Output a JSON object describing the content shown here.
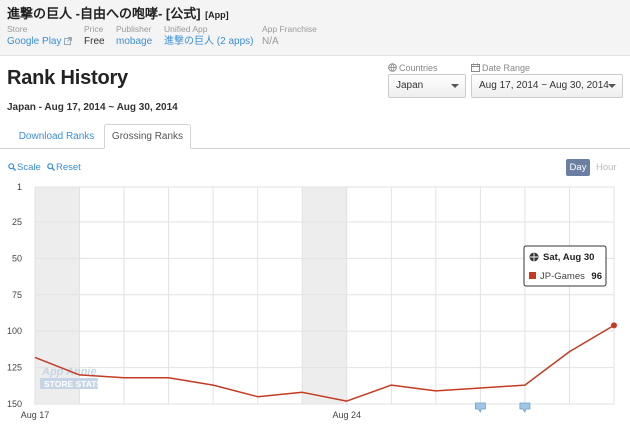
{
  "app": {
    "title": "進撃の巨人 -自由への咆哮- [公式]",
    "tag": "[App]",
    "meta": {
      "store": {
        "label": "Store",
        "value": "Google Play"
      },
      "price": {
        "label": "Price",
        "value": "Free"
      },
      "publisher": {
        "label": "Publisher",
        "value": "mobage"
      },
      "unified_app": {
        "label": "Unified App",
        "value": "進撃の巨人 (2 apps)"
      },
      "franchise": {
        "label": "App Franchise",
        "value": "N/A"
      }
    }
  },
  "page": {
    "title": "Rank History",
    "subtitle": "Japan - Aug 17, 2014 ~ Aug 30, 2014"
  },
  "filters": {
    "countries": {
      "label": "Countries",
      "value": "Japan"
    },
    "date_range": {
      "label": "Date Range",
      "value": "Aug 17, 2014 ~ Aug 30, 2014"
    }
  },
  "tabs": [
    {
      "label": "Download Ranks",
      "active": false
    },
    {
      "label": "Grossing Ranks",
      "active": true
    }
  ],
  "toolbar": {
    "scale_label": "Scale",
    "reset_label": "Reset",
    "granularity": {
      "day": "Day",
      "hour": "Hour",
      "selected": "Day"
    }
  },
  "tooltip": {
    "title": "Sat, Aug 30",
    "series": "JP-Games",
    "value": "96"
  },
  "watermark": {
    "line1": "App Annie",
    "line2": "STORE STATS"
  },
  "chart_data": {
    "type": "line",
    "y_reversed": true,
    "ylim": [
      1,
      150
    ],
    "yticks": [
      "1",
      "25",
      "50",
      "75",
      "100",
      "125",
      "150"
    ],
    "x_tick_labels": [
      {
        "day": 0,
        "label": "Aug 17"
      },
      {
        "day": 7,
        "label": "Aug 24"
      }
    ],
    "x": [
      "Aug 17",
      "Aug 18",
      "Aug 19",
      "Aug 20",
      "Aug 21",
      "Aug 22",
      "Aug 23",
      "Aug 24",
      "Aug 25",
      "Aug 26",
      "Aug 27",
      "Aug 28",
      "Aug 29",
      "Aug 30"
    ],
    "series": [
      {
        "name": "JP-Games",
        "color": "#c23b22",
        "values": [
          118,
          130,
          132,
          132,
          137,
          145,
          142,
          148,
          137,
          141,
          139,
          137,
          114,
          96
        ]
      }
    ],
    "weekend_bands": [
      [
        0,
        1
      ],
      [
        6,
        7
      ]
    ],
    "annotation_days": [
      10,
      11
    ],
    "grid": true
  }
}
